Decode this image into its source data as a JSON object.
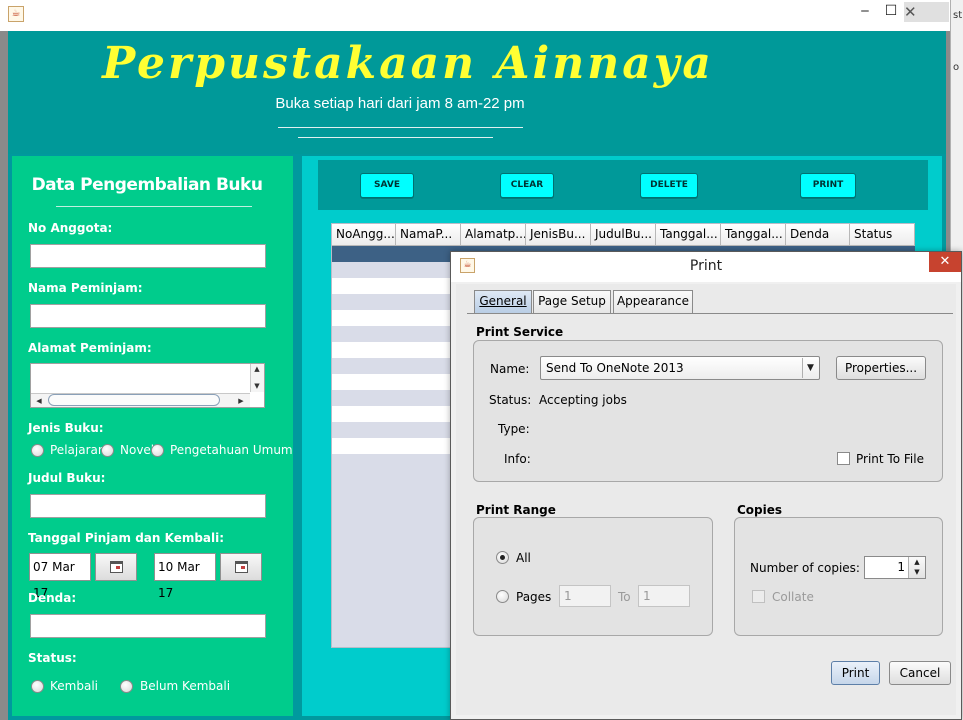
{
  "window": {
    "close_glyph": "✕",
    "minimize_glyph": "‒",
    "maximize_glyph": "☐",
    "app_icon_glyph": "☕"
  },
  "side_strip": {
    "text_1": "st",
    "text_2": "o"
  },
  "header": {
    "title": "Perpustakaan Ainnaya",
    "subtitle": "Buka setiap hari dari jam 8 am-22 pm",
    "color_title": "#ffff33",
    "color_bg": "#009999"
  },
  "form": {
    "title": "Data Pengembalian Buku",
    "no_anggota_label": "No Anggota:",
    "no_anggota_value": "",
    "nama_label": "Nama Peminjam:",
    "nama_value": "",
    "alamat_label": "Alamat Peminjam:",
    "alamat_value": "",
    "jenis_label": "Jenis Buku:",
    "jenis_options": [
      "Pelajaran",
      "Novel",
      "Pengetahuan Umum"
    ],
    "judul_label": "Judul Buku:",
    "judul_value": "",
    "tanggal_label": "Tanggal Pinjam dan Kembali:",
    "tanggal_pinjam": "07 Mar 17",
    "tanggal_kembali": "10 Mar 17",
    "denda_label": "Denda:",
    "denda_value": "",
    "status_label": "Status:",
    "status_options": [
      "Kembali",
      "Belum Kembali"
    ],
    "panel_color": "#00cc8c"
  },
  "actions": {
    "save": "SAVE",
    "clear": "CLEAR",
    "delete": "DELETE",
    "print": "PRINT",
    "button_color": "#00ffff"
  },
  "table": {
    "columns": [
      "NoAngg...",
      "NamaP...",
      "Alamatp...",
      "JenisBu...",
      "JudulBu...",
      "Tanggal...",
      "Tanggal...",
      "Denda",
      "Status"
    ],
    "selection_color": "#3d6185"
  },
  "print_dialog": {
    "title": "Print",
    "close_glyph": "✕",
    "tabs": {
      "general": "General",
      "page_setup": "Page Setup",
      "appearance": "Appearance"
    },
    "print_service": {
      "section": "Print Service",
      "name_label": "Name:",
      "name_value": "Send To OneNote 2013",
      "properties_button": "Properties...",
      "status_label": "Status:",
      "status_value": "Accepting jobs",
      "type_label": "Type:",
      "type_value": "",
      "info_label": "Info:",
      "info_value": "",
      "print_to_file": "Print To File"
    },
    "print_range": {
      "section": "Print Range",
      "all_label": "All",
      "pages_label": "Pages",
      "from_value": "1",
      "to_label": "To",
      "to_value": "1"
    },
    "copies": {
      "section": "Copies",
      "number_label": "Number of copies:",
      "number_value": "1",
      "collate_label": "Collate"
    },
    "print_button": "Print",
    "cancel_button": "Cancel"
  }
}
